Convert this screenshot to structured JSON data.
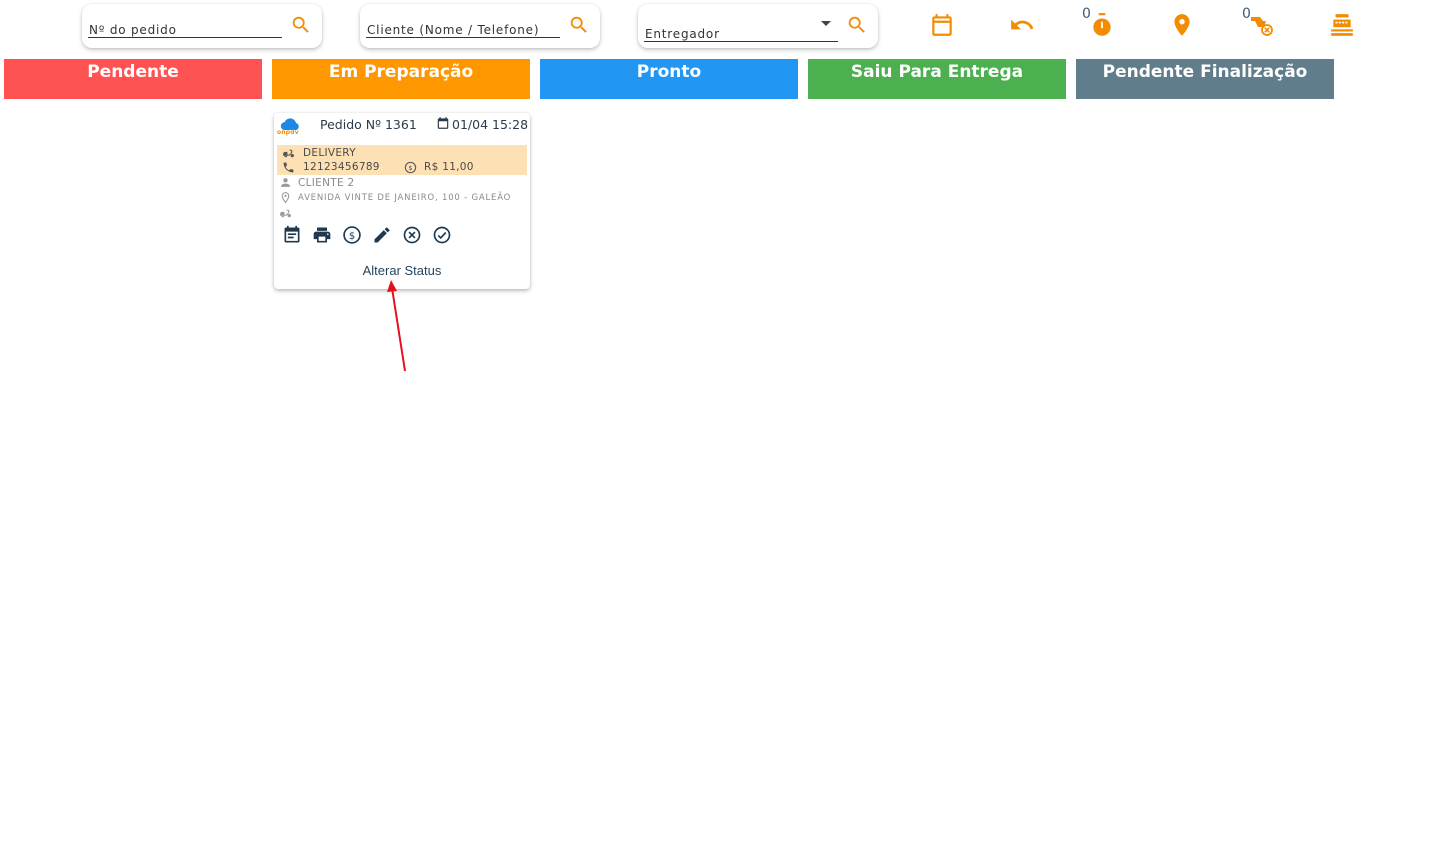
{
  "toolbar": {
    "order_number_placeholder": "Nº do pedido",
    "client_placeholder": "Cliente (Nome / Telefone)",
    "courier_placeholder": "Entregador",
    "timer_count": "0",
    "cancel_delivery_count": "0",
    "accent_color": "#f28c00",
    "icons": [
      "search-icon",
      "calendar-icon",
      "undo-icon",
      "timer-icon",
      "location-pin-icon",
      "delivery-cancel-icon",
      "cash-register-icon"
    ]
  },
  "columns": [
    {
      "label": "Pendente",
      "color": "#ff5252"
    },
    {
      "label": "Em Preparação",
      "color": "#ff9800"
    },
    {
      "label": "Pronto",
      "color": "#2196f3"
    },
    {
      "label": "Saiu Para Entrega",
      "color": "#4caf50"
    },
    {
      "label": "Pendente Finalização",
      "color": "#607d8b"
    }
  ],
  "order": {
    "logo_text": "onpdv",
    "number": "Pedido Nº 1361",
    "date": "01/04 15:28",
    "type": "DELIVERY",
    "phone": "12123456789",
    "amount": "R$ 11,00",
    "client": "CLIENTE 2",
    "address": "AVENIDA VINTE DE JANEIRO, 100 - GALEÃO",
    "band_color": "#fde0b4",
    "action_icons": [
      "order-details-icon",
      "print-icon",
      "payment-icon",
      "edit-icon",
      "cancel-icon",
      "confirm-icon"
    ],
    "alter_status_label": "Alterar Status"
  }
}
